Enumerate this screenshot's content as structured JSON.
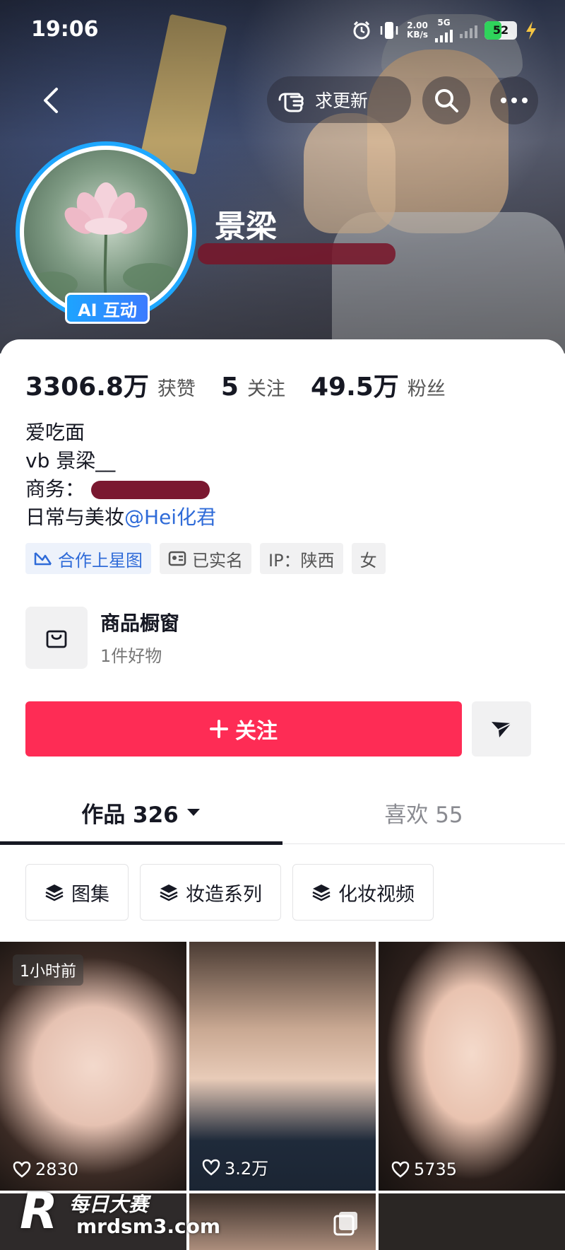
{
  "status_bar": {
    "time": "19:06",
    "speed_value": "2.00",
    "speed_unit": "KB/s",
    "network": "5G",
    "battery": "52",
    "battery_level": 0.52,
    "battery_color": "#2fd35b"
  },
  "header": {
    "update_button_label": "求更新",
    "back_icon": "chevron-left-icon",
    "search_icon": "search-icon",
    "more_icon": "more-dots-icon"
  },
  "profile": {
    "nickname": "景梁",
    "ai_badge": "AI 互动"
  },
  "stats": [
    {
      "value": "3306.8万",
      "label": "获赞"
    },
    {
      "value": "5",
      "label": "关注"
    },
    {
      "value": "49.5万",
      "label": "粉丝"
    }
  ],
  "bio": {
    "line1": "爱吃面",
    "line2": "vb 景梁__",
    "line3_prefix": "商务：",
    "line4_prefix": "日常与美妆",
    "line4_mention": "@Hei化君"
  },
  "tags": [
    {
      "label": "合作上星图",
      "icon": "star-chart-icon"
    },
    {
      "label": "已实名",
      "icon": "id-card-icon"
    },
    {
      "label": "IP：陕西"
    },
    {
      "label": "女"
    }
  ],
  "shop": {
    "title": "商品橱窗",
    "subtitle": "1件好物",
    "icon": "shopping-bag-icon"
  },
  "actions": {
    "follow_label": "关注",
    "follow_color": "#fe2c55",
    "send_icon": "send-icon"
  },
  "tabs": [
    {
      "label": "作品 326",
      "active": true
    },
    {
      "label": "喜欢 55",
      "active": false
    }
  ],
  "collections": [
    {
      "label": "图集",
      "icon": "layers-icon"
    },
    {
      "label": "妆造系列",
      "icon": "layers-icon"
    },
    {
      "label": "化妆视频",
      "icon": "layers-icon"
    }
  ],
  "videos": [
    {
      "likes": "2830",
      "badge": "1小时前"
    },
    {
      "likes": "3.2万"
    },
    {
      "likes": "5735"
    }
  ],
  "watermark": {
    "logo": "R",
    "title": "每日大赛",
    "url": "mrdsm3.com"
  },
  "colors": {
    "accent": "#fe2c55",
    "link": "#2f6bd8",
    "ai_badge": "#1da4ff"
  }
}
